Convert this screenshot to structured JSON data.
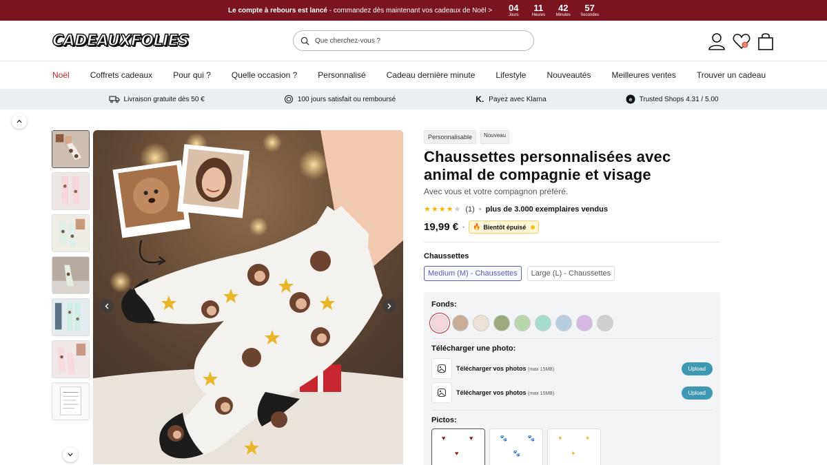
{
  "promo": {
    "bold": "Le compte à rebours est lancé",
    "text": " - commandez dès maintenant vos cadeaux de Noël >",
    "countdown": [
      {
        "value": "04",
        "label": "Jours"
      },
      {
        "value": "11",
        "label": "Heures"
      },
      {
        "value": "42",
        "label": "Minutes"
      },
      {
        "value": "57",
        "label": "Secondes"
      }
    ]
  },
  "header": {
    "logo": "CADEAUXFOLIES",
    "search_placeholder": "Que cherchez-vous ?",
    "wishlist_count": "0"
  },
  "nav": {
    "items": [
      "Noël",
      "Coffrets cadeaux",
      "Pour qui ?",
      "Quelle occasion ?",
      "Personnalisé",
      "Cadeau dernière minute",
      "Lifestyle",
      "Nouveautés",
      "Meilleures ventes",
      "Trouver un cadeau"
    ]
  },
  "usp": {
    "items": [
      {
        "icon": "truck-icon",
        "text": "Livraison gratuite dès 50 €"
      },
      {
        "icon": "return-icon",
        "text": "100 jours satisfait ou remboursé"
      },
      {
        "icon": "klarna-icon",
        "text": "Payez avec Klarna"
      },
      {
        "icon": "trusted-shops-icon",
        "text": "Trusted Shops 4.31 / 5.00"
      }
    ]
  },
  "product": {
    "tags": [
      "Personnalisable",
      "Nouveau"
    ],
    "title": "Chaussettes personnalisées avec animal de compagnie et visage",
    "subtitle": "Avec vous et votre compagnon préféré.",
    "rating": 4,
    "review_count": "(1)",
    "sold": "plus de 3.000 exemplaires vendus",
    "price": "19,99 €",
    "stock_badge": "Bientôt épuisé",
    "variant_label": "Chaussettes",
    "variants": [
      "Medium (M) - Chaussettes",
      "Large (L) - Chaussettes"
    ],
    "selected_variant": 0
  },
  "customizer": {
    "backgrounds_label": "Fonds:",
    "backgrounds": [
      "#f3d6da",
      "#c6ad9a",
      "#ede1d5",
      "#9bab7e",
      "#b9d7ae",
      "#a6dccf",
      "#b9cde0",
      "#d6b9e2",
      "#cfcfcf"
    ],
    "upload_label": "Télécharger une photo:",
    "uploads": [
      {
        "text": "Télécharger vos photos",
        "note": "(max 15MB)",
        "button": "Upload"
      },
      {
        "text": "Télécharger vos photos",
        "note": "(max 15MB)",
        "button": "Upload"
      }
    ],
    "pictos_label": "Pictos:"
  },
  "colors": {
    "promo_bg": "#7a1420",
    "accent": "#c0262f",
    "usp_bg": "#e8f0f4",
    "upload_btn": "#3f98b3"
  }
}
